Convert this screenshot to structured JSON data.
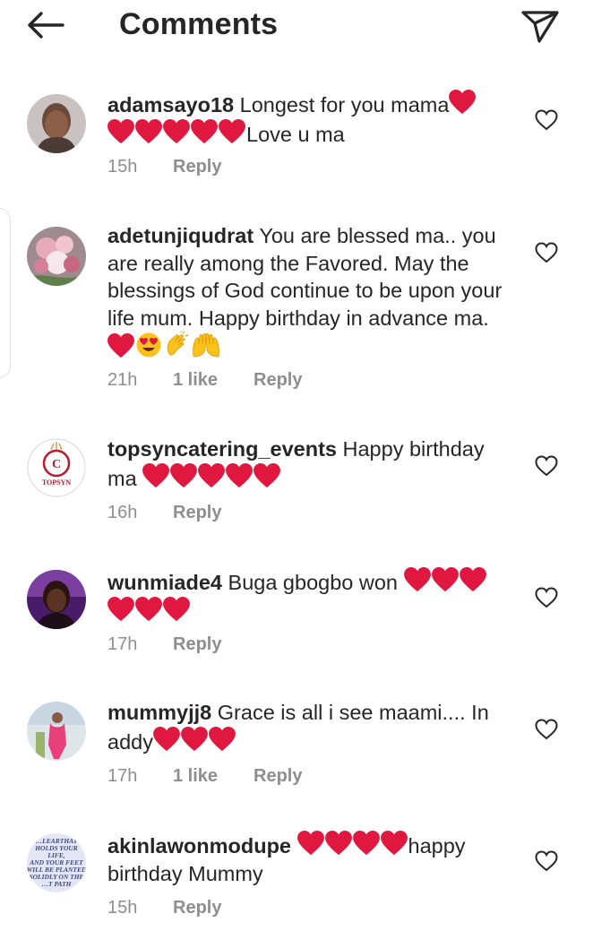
{
  "header": {
    "title": "Comments"
  },
  "comments": [
    {
      "username": "adamsayo18",
      "text": "Longest for you mama",
      "text_after": "Love u ma",
      "hearts_inline": 1,
      "hearts_after": 5,
      "time": "15h",
      "likes": "",
      "reply": "Reply"
    },
    {
      "username": "adetunjiqudrat",
      "text": "You are blessed ma.. you are really among the Favored. May the blessings of God continue to be upon your life mum. Happy birthday in advance ma.",
      "time": "21h",
      "likes": "1 like",
      "reply": "Reply"
    },
    {
      "username": "topsyncatering_events",
      "text": "Happy birthday ma",
      "time": "16h",
      "likes": "",
      "reply": "Reply"
    },
    {
      "username": "wunmiade4",
      "text": "Buga gbogbo won",
      "time": "17h",
      "likes": "",
      "reply": "Reply"
    },
    {
      "username": "mummyjj8",
      "text": "Grace is all i see maami.... In addy",
      "time": "17h",
      "likes": "1 like",
      "reply": "Reply"
    },
    {
      "username": "akinlawonmodupe",
      "text": "happy birthday Mummy",
      "time": "15h",
      "likes": "",
      "reply": "Reply"
    }
  ],
  "avatar_texts": {
    "topsyn": "TOPSYN",
    "modupe": [
      "…LEARTHAT",
      "HOLDS YOUR",
      "LIFE,",
      "AND YOUR FEET",
      "WILL BE PLANTED",
      "SOLIDLY ON THE",
      "…T PATH"
    ]
  },
  "colors": {
    "text": "#262626",
    "meta": "#8e8e8e",
    "heart": "#e0173f"
  },
  "icons": [
    "back-arrow-icon",
    "send-icon",
    "heart-outline-icon",
    "red-heart-emoji",
    "heart-eyes-emoji",
    "clapping-hands-emoji",
    "raised-hands-emoji"
  ]
}
